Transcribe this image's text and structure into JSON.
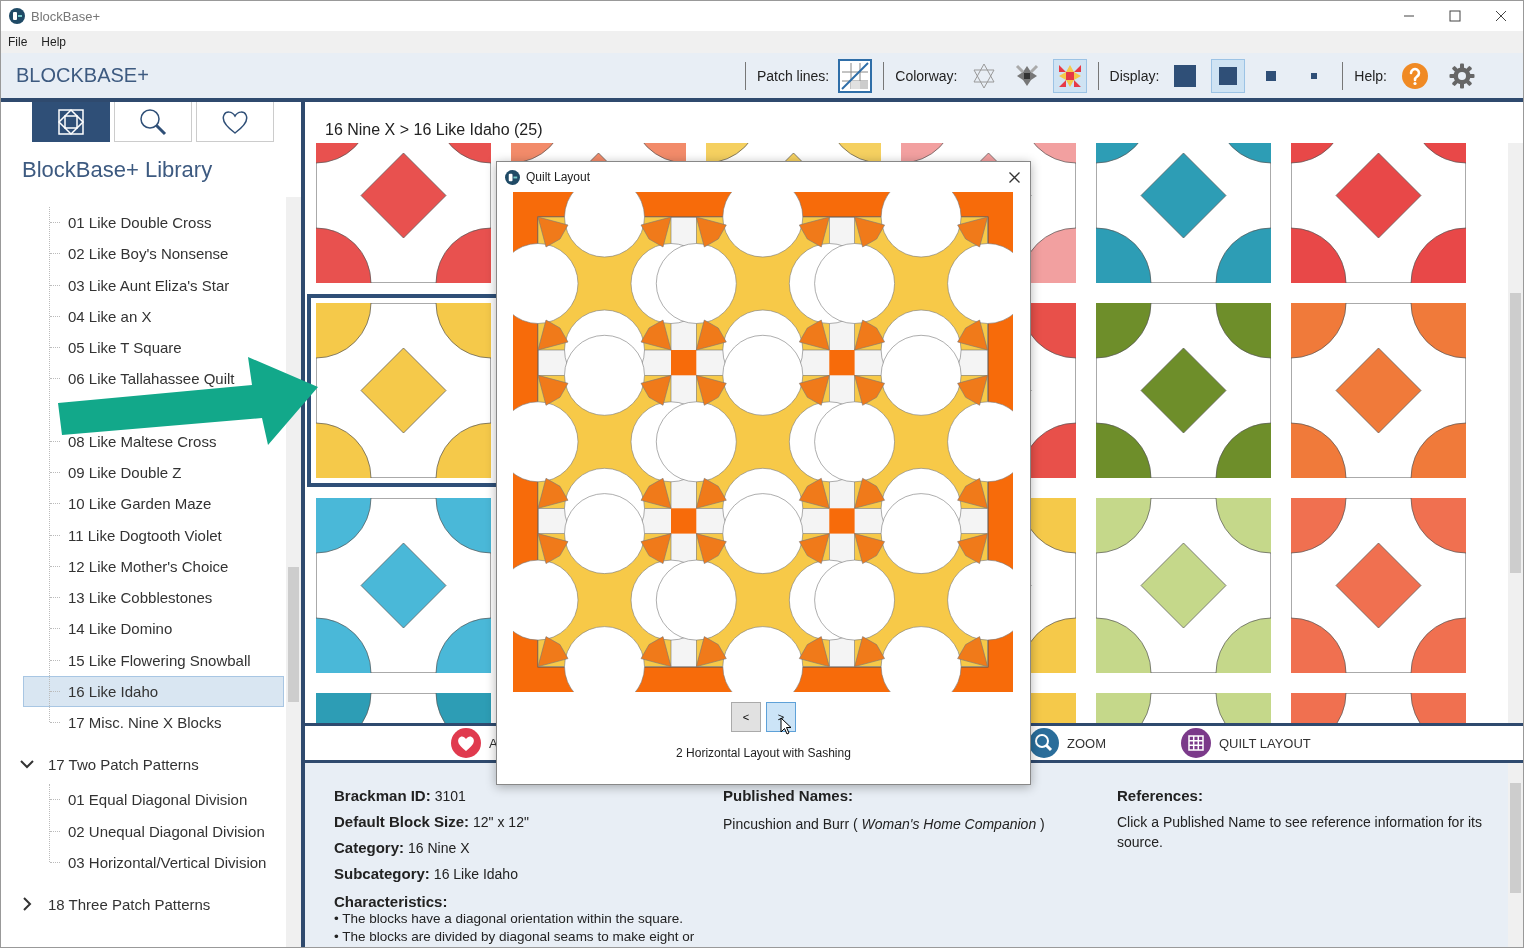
{
  "window": {
    "title": "BlockBase+"
  },
  "menu": [
    "File",
    "Help"
  ],
  "header": {
    "title": "BLOCKBASE+",
    "toolbar": {
      "patch_lines": {
        "label": "Patch lines:",
        "on": true
      },
      "colorway": {
        "label": "Colorway:",
        "options": [
          {
            "kind": "outline",
            "selected": false
          },
          {
            "kind": "grey",
            "selected": false
          },
          {
            "kind": "color",
            "selected": true
          }
        ]
      },
      "display": {
        "label": "Display:",
        "options": [
          {
            "kind": "large",
            "selected": false
          },
          {
            "kind": "medium",
            "selected": true
          },
          {
            "kind": "small",
            "selected": false
          },
          {
            "kind": "tiny",
            "selected": false
          }
        ]
      },
      "help": {
        "label": "Help:"
      }
    }
  },
  "sidebar": {
    "tabs": [
      {
        "kind": "library",
        "selected": true
      },
      {
        "kind": "search",
        "selected": false
      },
      {
        "kind": "favorites",
        "selected": false
      }
    ],
    "heading": "BlockBase+ Library",
    "tree": [
      {
        "children": [
          {
            "label": "01 Like Double Cross",
            "selected": false
          },
          {
            "label": "02 Like Boy's Nonsense",
            "selected": false
          },
          {
            "label": "03 Like Aunt Eliza's Star",
            "selected": false
          },
          {
            "label": "04 Like an X",
            "selected": false
          },
          {
            "label": "05 Like T Square",
            "selected": false
          },
          {
            "label": "06 Like Tallahassee Quilt",
            "selected": false
          },
          {
            "label": "08 Like Maltese Cross",
            "selected": false
          },
          {
            "label": "09 Like Double Z",
            "selected": false
          },
          {
            "label": "10 Like Garden Maze",
            "selected": false
          },
          {
            "label": "11 Like Dogtooth Violet",
            "selected": false
          },
          {
            "label": "12 Like Mother's Choice",
            "selected": false
          },
          {
            "label": "13 Like Cobblestones",
            "selected": false
          },
          {
            "label": "14 Like Domino",
            "selected": false
          },
          {
            "label": "15 Like Flowering Snowball",
            "selected": false
          },
          {
            "label": "16 Like Idaho",
            "selected": true
          },
          {
            "label": "17 Misc. Nine X Blocks",
            "selected": false
          }
        ]
      },
      {
        "label": "17 Two Patch Patterns",
        "expanded": true,
        "children": [
          {
            "label": "01 Equal Diagonal Division",
            "selected": false
          },
          {
            "label": "02 Unequal Diagonal Division",
            "selected": false
          },
          {
            "label": "03 Horizontal/Vertical Division",
            "selected": false
          }
        ]
      },
      {
        "label": "18 Three Patch Patterns",
        "expanded": false
      }
    ]
  },
  "main": {
    "breadcrumb": "16 Nine X > 16 Like Idaho (25)",
    "block_rows": [
      {
        "blocks": [
          {
            "color": "#e8514f",
            "selected": false
          },
          {
            "color": "#f28b6a",
            "selected": false
          },
          {
            "color": "#f5d060",
            "selected": false
          },
          {
            "color": "#f2a0a0",
            "selected": false
          },
          {
            "color": "#2d9db5",
            "selected": false
          },
          {
            "color": "#e84848",
            "selected": false
          }
        ]
      },
      {
        "blocks": [
          {
            "color": "#f5c94a",
            "selected": true
          },
          {
            "color": "#e8504a",
            "selected": false
          },
          {
            "color": "#6e8e2a",
            "selected": false
          },
          {
            "color": "#f07a3a",
            "selected": false
          }
        ]
      },
      {
        "blocks": [
          {
            "color": "#4ab8d8",
            "selected": false
          },
          {
            "color": "#f5c94a",
            "selected": false
          },
          {
            "color": "#c5d88a",
            "selected": false
          },
          {
            "color": "#f07050",
            "selected": false
          }
        ]
      },
      {
        "blocks": [
          {
            "color": "#2d9db5",
            "selected": false
          },
          {
            "color": "#f5c94a",
            "selected": false
          },
          {
            "color": "#c5d88a",
            "selected": false
          },
          {
            "color": "#f07050",
            "selected": false
          }
        ]
      }
    ],
    "actions": [
      {
        "kind": "favorite",
        "label": "A"
      },
      {
        "kind": "zoom",
        "label": "ZOOM"
      },
      {
        "kind": "quilt",
        "label": "QUILT LAYOUT"
      }
    ],
    "details": {
      "fields": [
        {
          "label": "Brackman ID:",
          "value": "3101"
        },
        {
          "label": "Default Block Size:",
          "value": "12\" x 12\""
        },
        {
          "label": "Category:",
          "value": "16 Nine X"
        },
        {
          "label": "Subcategory:",
          "value": "16 Like Idaho"
        }
      ],
      "characteristics": {
        "heading": "Characteristics:",
        "items": [
          "• The blocks have a diagonal orientation within the square.",
          "• The blocks are divided by diagonal seams to make eight or"
        ]
      },
      "published": {
        "heading": "Published Names:",
        "names": [
          "Pincushion and Burr ( *Woman's Home Companion* )"
        ]
      },
      "references": {
        "heading": "References:",
        "text": "Click a Published Name to see reference information for its source."
      }
    }
  },
  "dialog": {
    "title": "Quilt Layout",
    "pager": [
      {
        "label": "<",
        "selected": false
      },
      {
        "label": ">",
        "selected": true
      }
    ],
    "caption": "2 Horizontal Layout with Sashing"
  }
}
